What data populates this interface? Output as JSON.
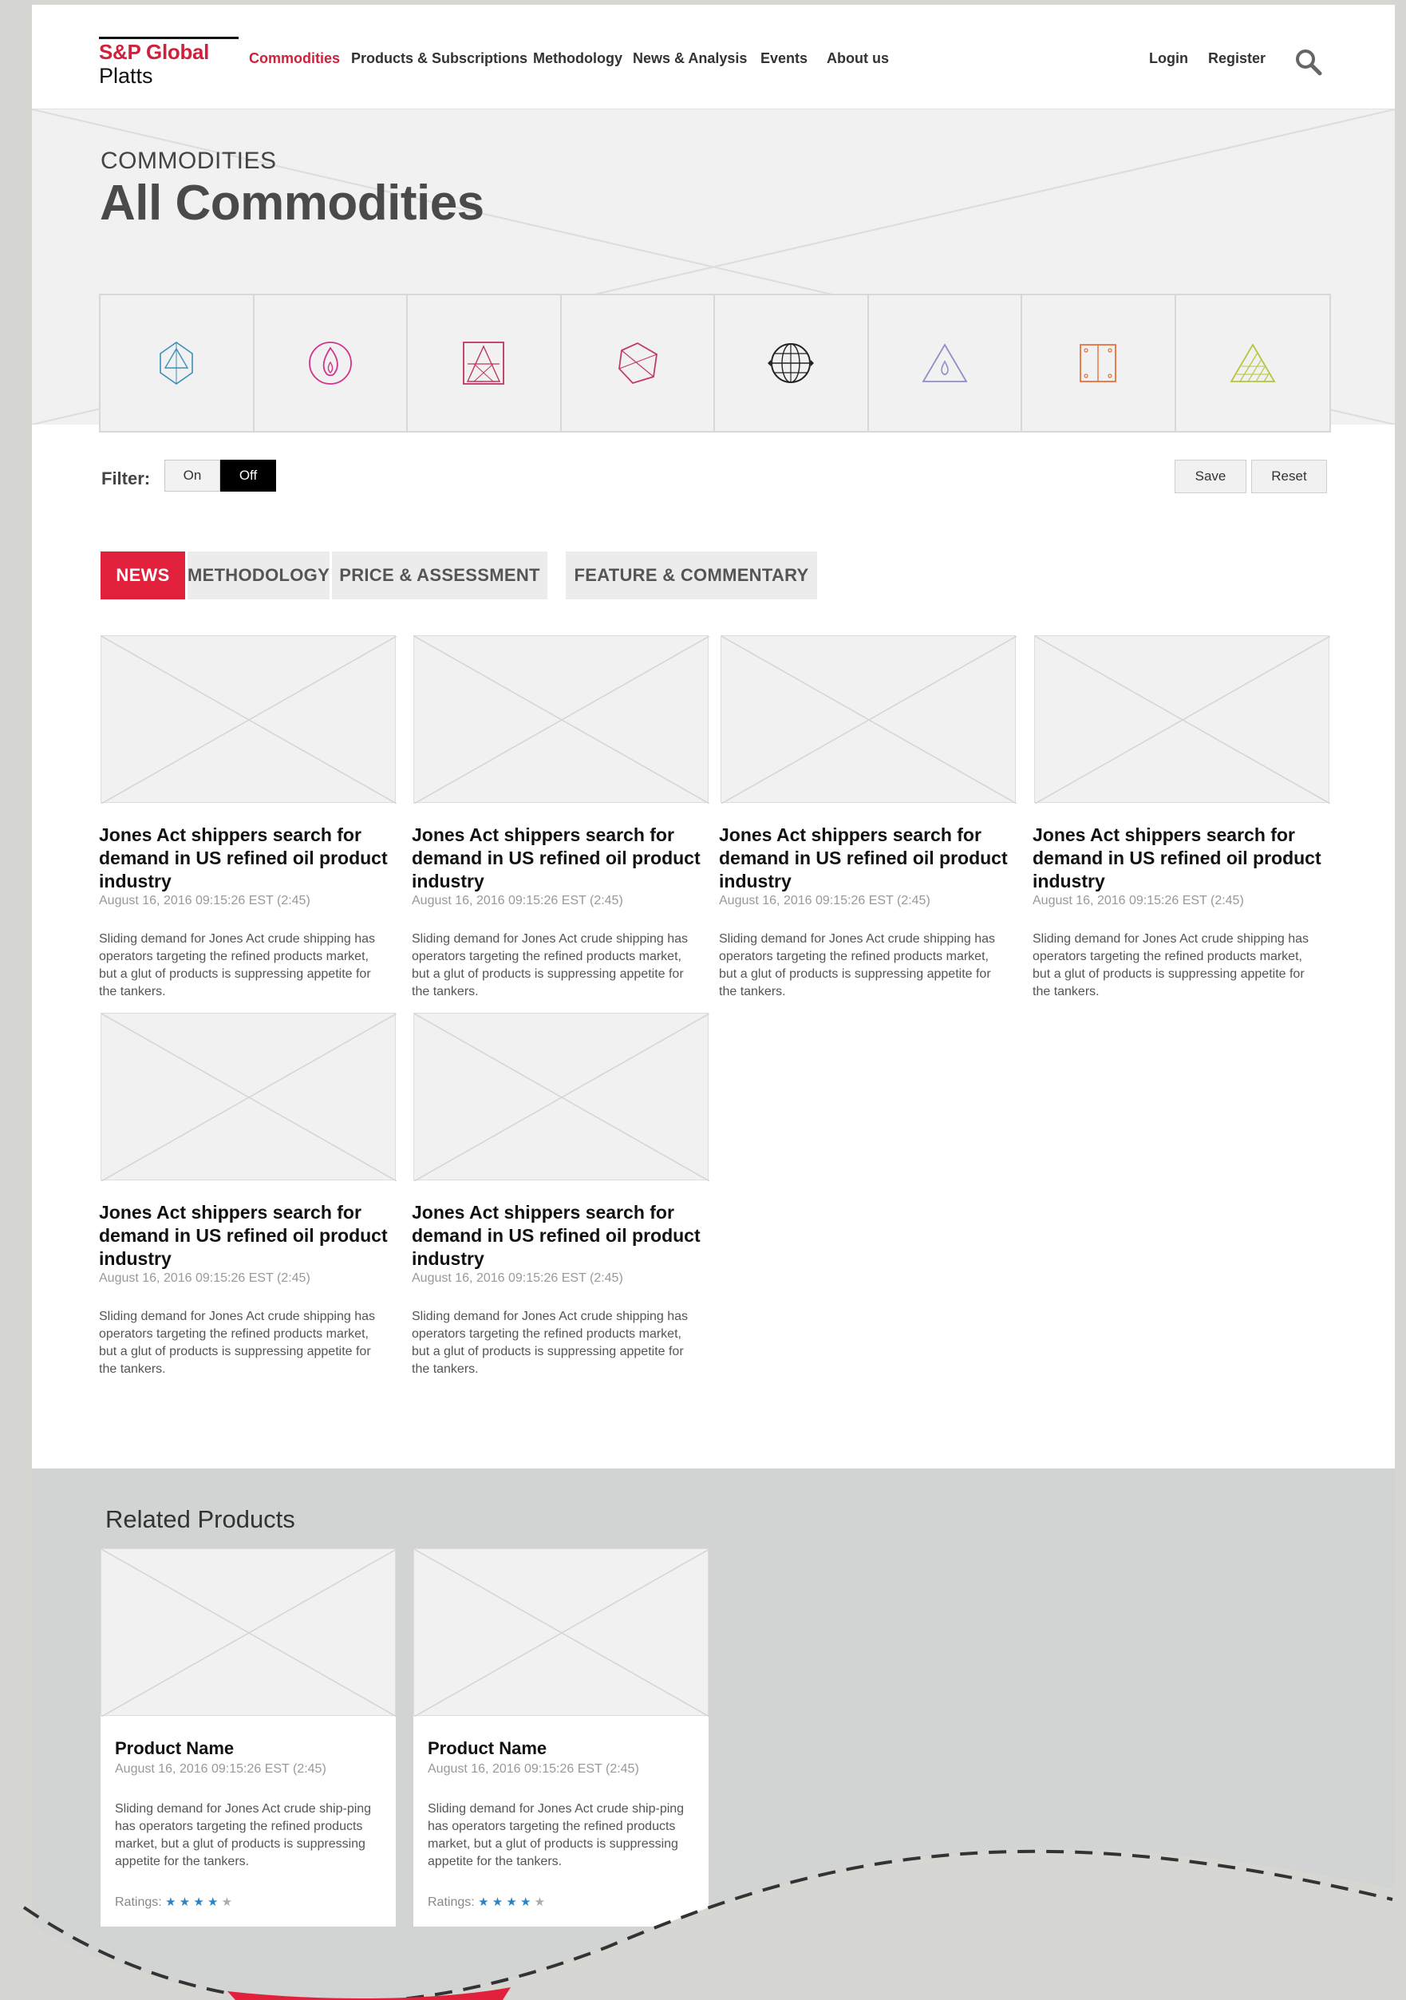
{
  "header": {
    "logo": {
      "brand": "S&P Global",
      "product": "Platts"
    },
    "nav": [
      "Commodities",
      "Products & Subscriptions",
      "Methodology",
      "News & Analysis",
      "Events",
      "About us"
    ],
    "active_nav": "Commodities",
    "login": "Login",
    "register": "Register",
    "search_icon": "search-icon"
  },
  "hero": {
    "eyebrow": "COMMODITIES",
    "title": "All Commodities",
    "commodity_icons": [
      {
        "icon": "crystal-icon",
        "color": "#3b8fb9"
      },
      {
        "icon": "flame-icon",
        "color": "#d1338a"
      },
      {
        "icon": "tower-icon",
        "color": "#c0355a"
      },
      {
        "icon": "polygon-icon",
        "color": "#c03a6b"
      },
      {
        "icon": "globe-icon",
        "color": "#222222"
      },
      {
        "icon": "drop-triangle-icon",
        "color": "#8f8fc8"
      },
      {
        "icon": "panel-icon",
        "color": "#e8703a"
      },
      {
        "icon": "striped-triangle-icon",
        "color": "#b9c43b"
      }
    ]
  },
  "filter": {
    "label": "Filter:",
    "on": "On",
    "off": "Off",
    "save": "Save",
    "reset": "Reset"
  },
  "tabs": [
    "NEWS",
    "METHODOLOGY",
    "PRICE & ASSESSMENT",
    "FEATURE & COMMENTARY"
  ],
  "active_tab": "NEWS",
  "articles": [
    {
      "title": "Jones Act shippers search for demand in US refined oil product industry",
      "date": "August 16, 2016 09:15:26 EST (2:45)",
      "body": "Sliding demand for Jones Act crude shipping has operators targeting the refined products market, but a glut of products is suppressing appetite for the tankers."
    },
    {
      "title": "Jones Act shippers search for demand in US refined oil product industry",
      "date": "August 16, 2016 09:15:26 EST (2:45)",
      "body": "Sliding demand for Jones Act crude shipping has operators targeting the refined products market, but a glut of products is suppressing appetite for the tankers."
    },
    {
      "title": "Jones Act shippers search for demand in US refined oil product industry",
      "date": "August 16, 2016 09:15:26 EST (2:45)",
      "body": "Sliding demand for Jones Act crude shipping has operators targeting the refined products market, but a glut of products is suppressing appetite for the tankers."
    },
    {
      "title": "Jones Act shippers search for demand in US refined oil product industry",
      "date": "August 16, 2016 09:15:26 EST (2:45)",
      "body": "Sliding demand for Jones Act crude shipping has operators targeting the refined products market, but a glut of products is suppressing appetite for the tankers."
    },
    {
      "title": "Jones Act shippers search for demand in US refined oil product industry",
      "date": "August 16, 2016 09:15:26 EST (2:45)",
      "body": "Sliding demand for Jones Act crude shipping has operators targeting the refined products market, but a glut of products is suppressing appetite for the tankers."
    },
    {
      "title": "Jones Act shippers search for demand in US refined oil product industry",
      "date": "August 16, 2016 09:15:26 EST (2:45)",
      "body": "Sliding demand for Jones Act crude shipping has operators targeting the refined products market, but a glut of products is suppressing appetite for the tankers."
    }
  ],
  "related": {
    "title": "Related Products",
    "products": [
      {
        "name": "Product Name",
        "date": "August 16, 2016 09:15:26 EST (2:45)",
        "body": "Sliding demand for Jones Act crude ship-ping has operators targeting the refined products market, but a glut of products is suppressing appetite for the tankers.",
        "ratings_label": "Ratings:",
        "rating": 4,
        "rating_max": 5
      },
      {
        "name": "Product Name",
        "date": "August 16, 2016 09:15:26 EST (2:45)",
        "body": "Sliding demand for Jones Act crude ship-ping has operators targeting the refined products market, but a glut of products is suppressing appetite for the tankers.",
        "ratings_label": "Ratings:",
        "rating": 4,
        "rating_max": 5
      }
    ]
  },
  "colors": {
    "accent": "#e1213b",
    "brand_red": "#d0213c"
  }
}
